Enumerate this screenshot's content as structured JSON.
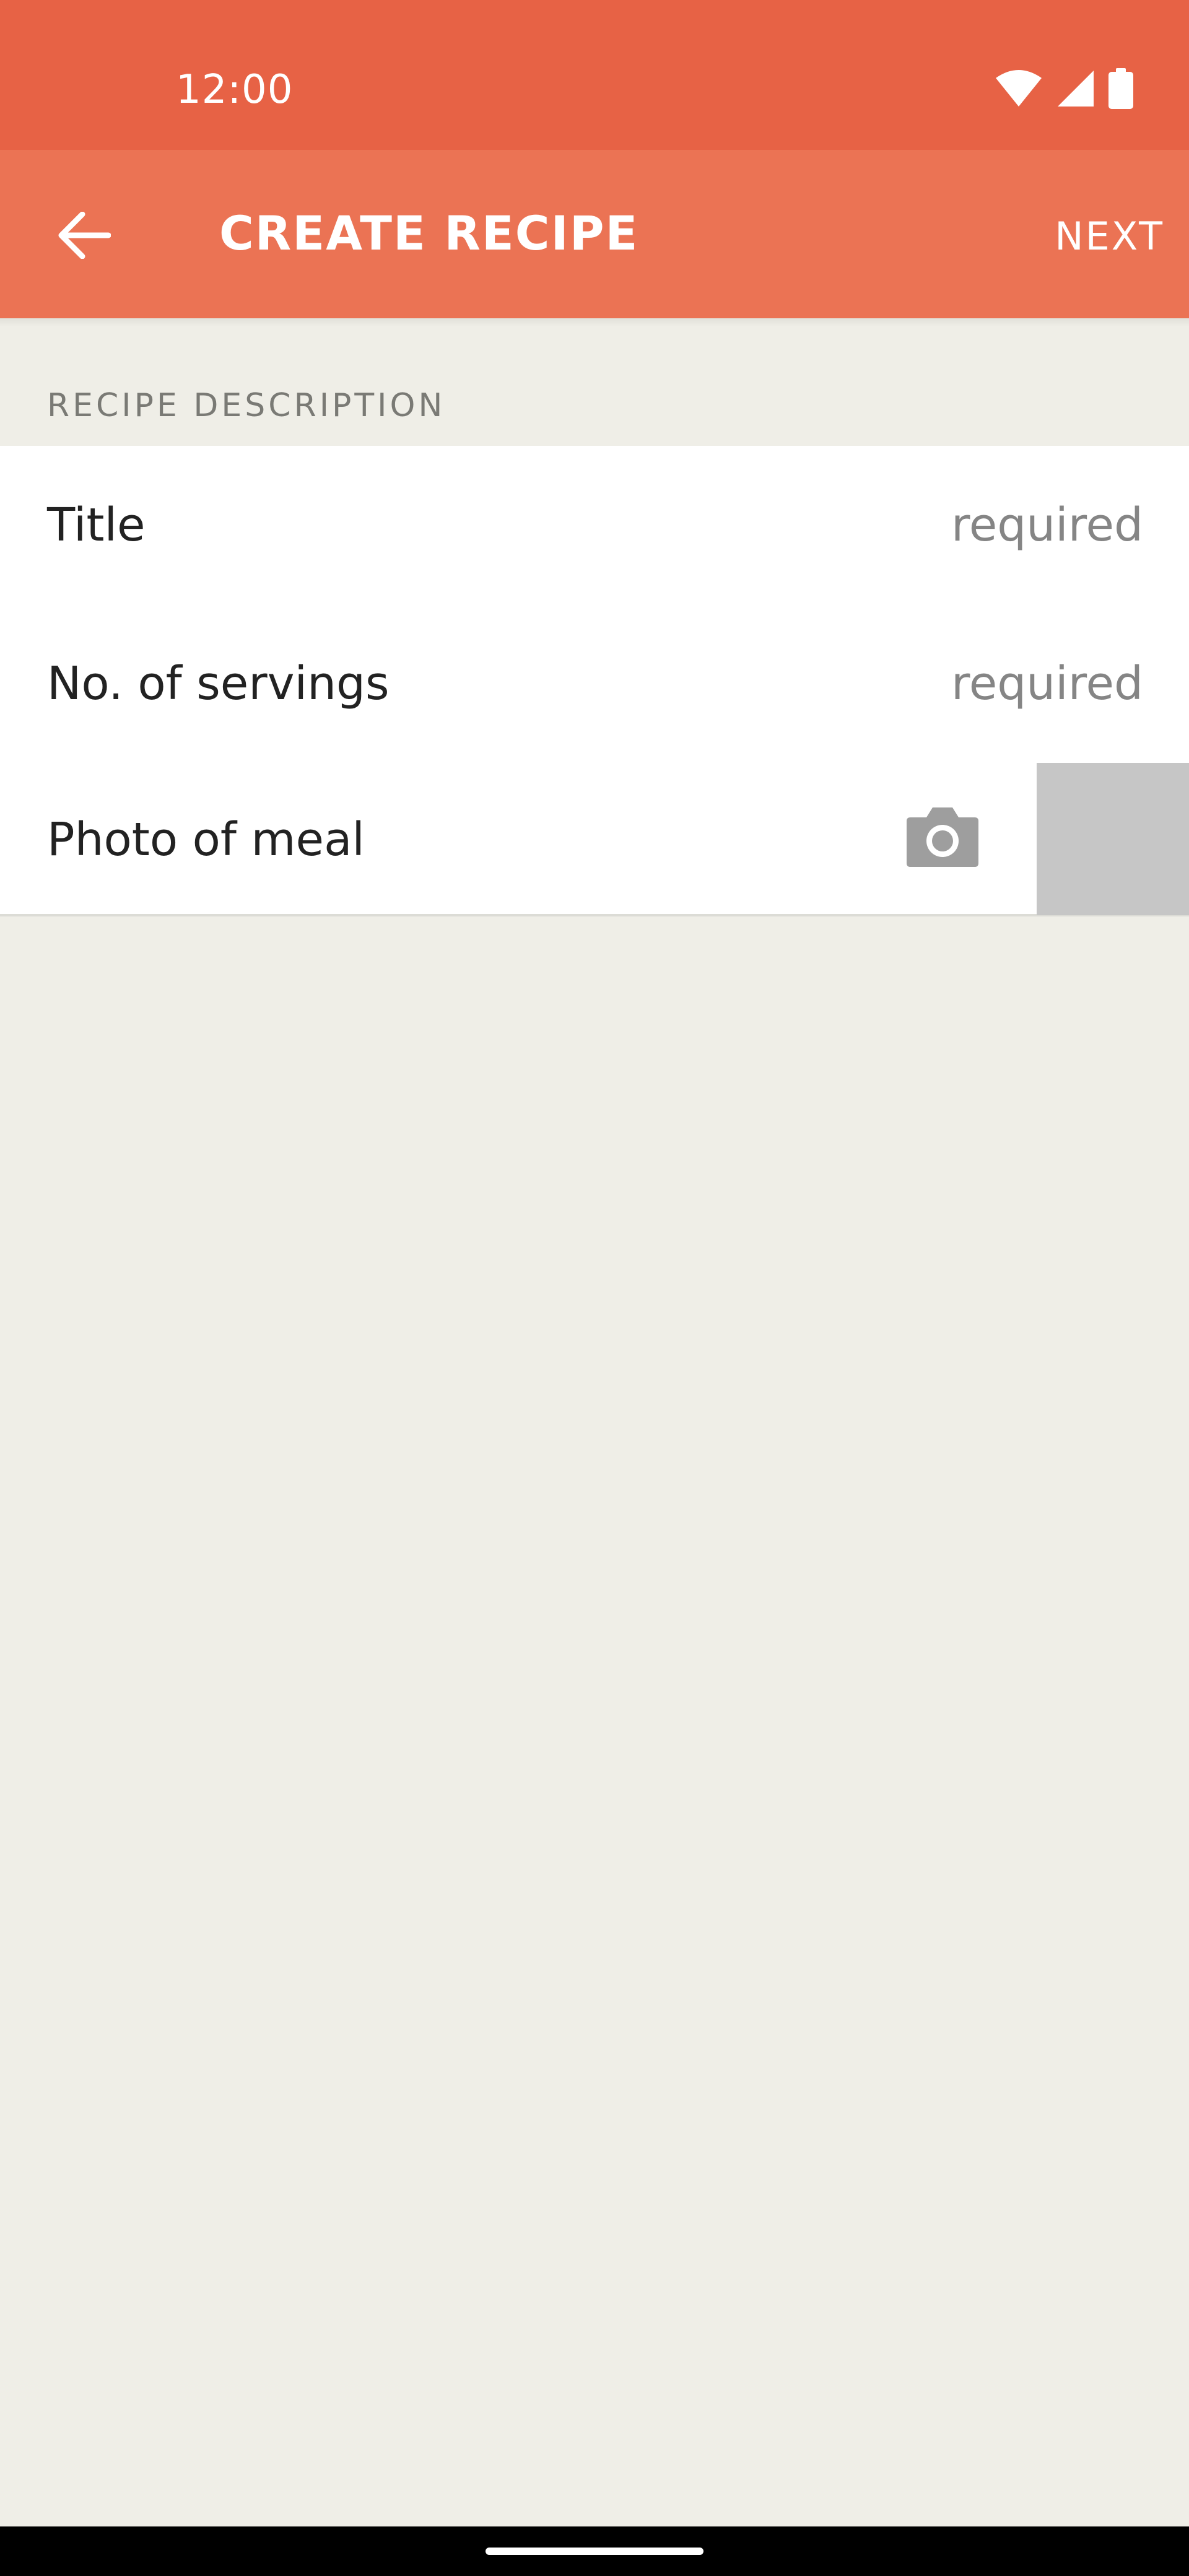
{
  "status_bar": {
    "time": "12:00",
    "icons": [
      "wifi-icon",
      "cellular-signal-icon",
      "battery-icon"
    ]
  },
  "app_bar": {
    "title": "CREATE RECIPE",
    "back_icon": "arrow-back-icon",
    "next_label": "NEXT"
  },
  "section": {
    "header": "RECIPE DESCRIPTION"
  },
  "form": {
    "rows": [
      {
        "label": "Title",
        "hint": "required"
      },
      {
        "label": "No. of servings",
        "hint": "required"
      },
      {
        "label": "Photo of meal",
        "icon": "camera-icon"
      }
    ]
  },
  "colors": {
    "status_bar": "#E76245",
    "app_bar": "#EB7354",
    "background": "#EFEEE7",
    "card": "#FFFFFF",
    "photo_placeholder": "#C6C6C6"
  }
}
